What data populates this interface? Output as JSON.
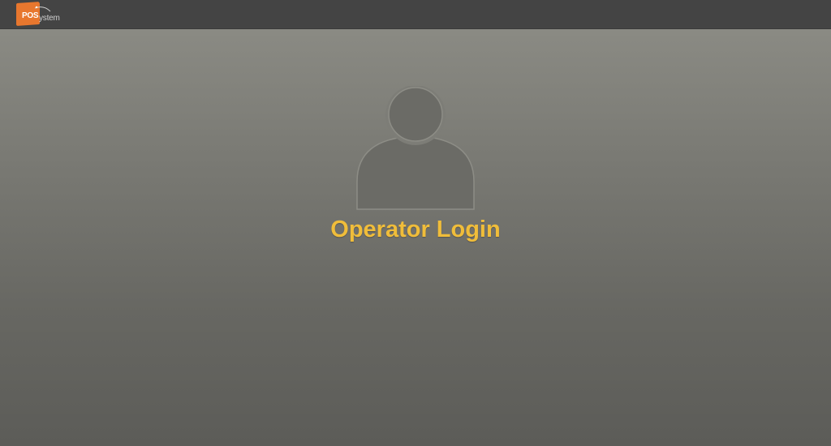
{
  "header": {
    "logo": {
      "brand_prefix": "POS",
      "brand_suffix": "ystem"
    }
  },
  "login": {
    "avatar_icon": "user-silhouette-icon",
    "title": "Operator Login"
  },
  "colors": {
    "topbar": "#444444",
    "logo_accent": "#e8772e",
    "title": "#f0bd3a",
    "avatar_fill": "#6b6b66"
  }
}
